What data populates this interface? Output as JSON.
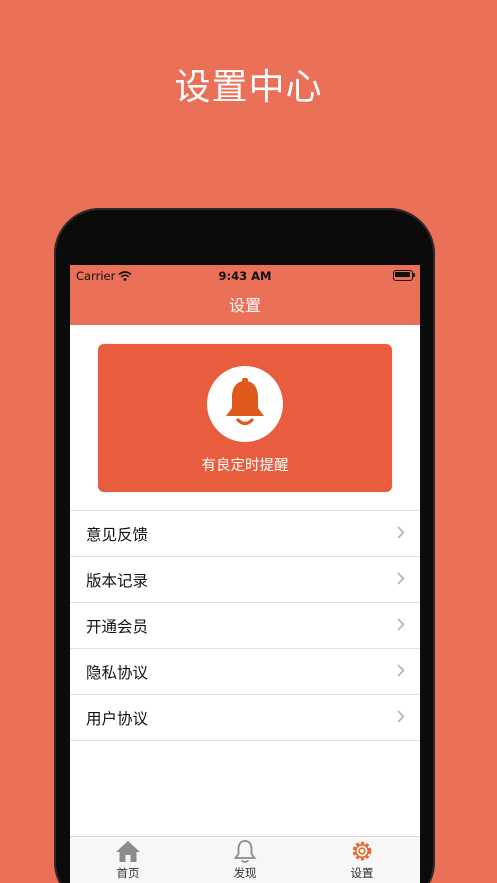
{
  "promo_title": "设置中心",
  "status_bar": {
    "carrier": "Carrier",
    "time": "9:43 AM"
  },
  "navbar": {
    "title": "设置"
  },
  "reminder_card": {
    "label": "有良定时提醒",
    "icon": "bell-icon"
  },
  "menu": [
    {
      "label": "意见反馈"
    },
    {
      "label": "版本记录"
    },
    {
      "label": "开通会员"
    },
    {
      "label": "隐私协议"
    },
    {
      "label": "用户协议"
    }
  ],
  "tabs": [
    {
      "label": "首页",
      "icon": "home-icon"
    },
    {
      "label": "发现",
      "icon": "bell-icon"
    },
    {
      "label": "设置",
      "icon": "gear-icon"
    }
  ],
  "colors": {
    "accent": "#EB7058",
    "card": "#E85D3E",
    "bell": "#E05A1E",
    "active_tab": "#E8682F"
  }
}
